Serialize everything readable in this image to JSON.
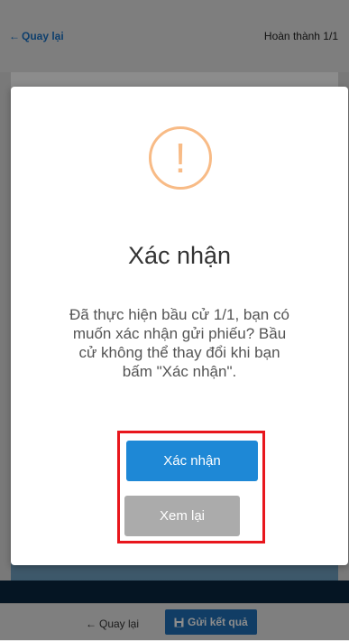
{
  "topbar": {
    "back_label": "Quay lại",
    "status": "Hoàn thành 1/1"
  },
  "bottombar": {
    "back_label": "Quay lại",
    "send_label": "Gửi kết quả"
  },
  "modal": {
    "icon": "exclamation-icon",
    "title": "Xác nhận",
    "message": "Đã thực hiện bầu cử 1/1, bạn có muốn xác nhận gửi phiếu? Bầu cử không thể thay đổi khi bạn bấm \"Xác nhận\".",
    "confirm_label": "Xác nhận",
    "review_label": "Xem lại"
  },
  "colors": {
    "accent": "#1e88d6",
    "warning": "#f8bb86",
    "highlight_frame": "#e8161c",
    "review_button": "#ababab"
  }
}
